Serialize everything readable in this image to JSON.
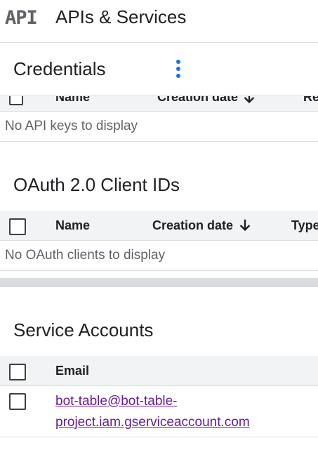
{
  "topbar": {
    "logo_text": "API",
    "title": "APIs & Services"
  },
  "credentials": {
    "title": "Credentials",
    "api_keys_table": {
      "columns": [
        "Name",
        "Creation date",
        "Re"
      ],
      "empty_text": "No API keys to display"
    }
  },
  "oauth": {
    "title": "OAuth 2.0 Client IDs",
    "columns": [
      "Name",
      "Creation date",
      "Type"
    ],
    "empty_text": "No OAuth clients to display"
  },
  "service_accounts": {
    "title": "Service Accounts",
    "columns": [
      "Email"
    ],
    "rows": [
      {
        "email_line1": "bot-table@bot-table-",
        "email_line2": "project.iam.gserviceaccount.com"
      }
    ]
  },
  "colors": {
    "accent": "#1a73e8",
    "visited_link": "#6a1b9a",
    "header_bg": "#f1f3f4"
  }
}
